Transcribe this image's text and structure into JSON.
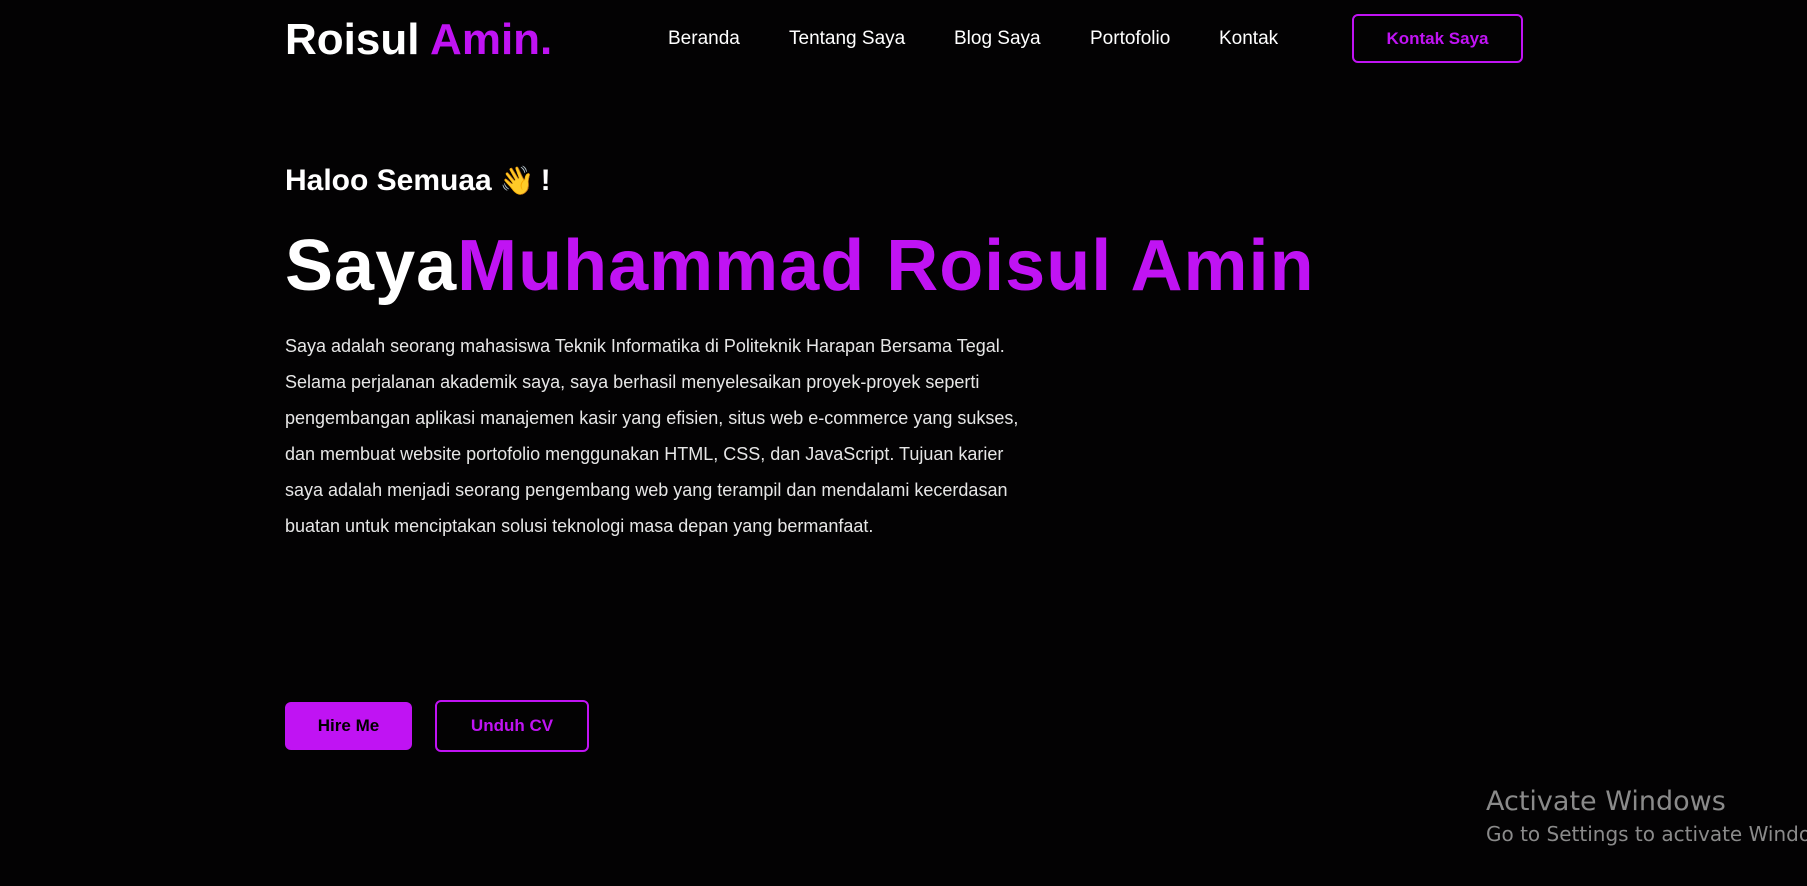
{
  "header": {
    "logo_text": "Roisul ",
    "logo_accent": "Amin.",
    "nav": [
      {
        "label": "Beranda"
      },
      {
        "label": "Tentang Saya"
      },
      {
        "label": "Blog Saya"
      },
      {
        "label": "Portofolio"
      },
      {
        "label": "Kontak"
      }
    ],
    "contact_button": "Kontak Saya"
  },
  "hero": {
    "greeting": "Haloo Semuaa",
    "greeting_icon": "waving-hand-icon",
    "greeting_emoji": "👋",
    "greeting_suffix": "!",
    "headline_prefix": "Saya",
    "headline_name": "Muhammad Roisul Amin",
    "bio": "Saya adalah seorang mahasiswa Teknik Informatika di Politeknik Harapan Bersama Tegal. Selama perjalanan akademik saya, saya berhasil menyelesaikan proyek-proyek seperti pengembangan aplikasi manajemen kasir yang efisien, situs web e-commerce yang sukses, dan membuat website portofolio menggunakan HTML, CSS, dan JavaScript. Tujuan karier saya adalah menjadi seorang pengembang web yang terampil dan mendalami kecerdasan buatan untuk menciptakan solusi teknologi masa depan yang bermanfaat.",
    "hire_button": "Hire Me",
    "cv_button": "Unduh CV"
  },
  "watermark": {
    "title": "Activate Windows",
    "subtitle": "Go to Settings to activate Windows."
  },
  "colors": {
    "background": "#030203",
    "accent": "#c013f3",
    "text": "#ffffff"
  }
}
